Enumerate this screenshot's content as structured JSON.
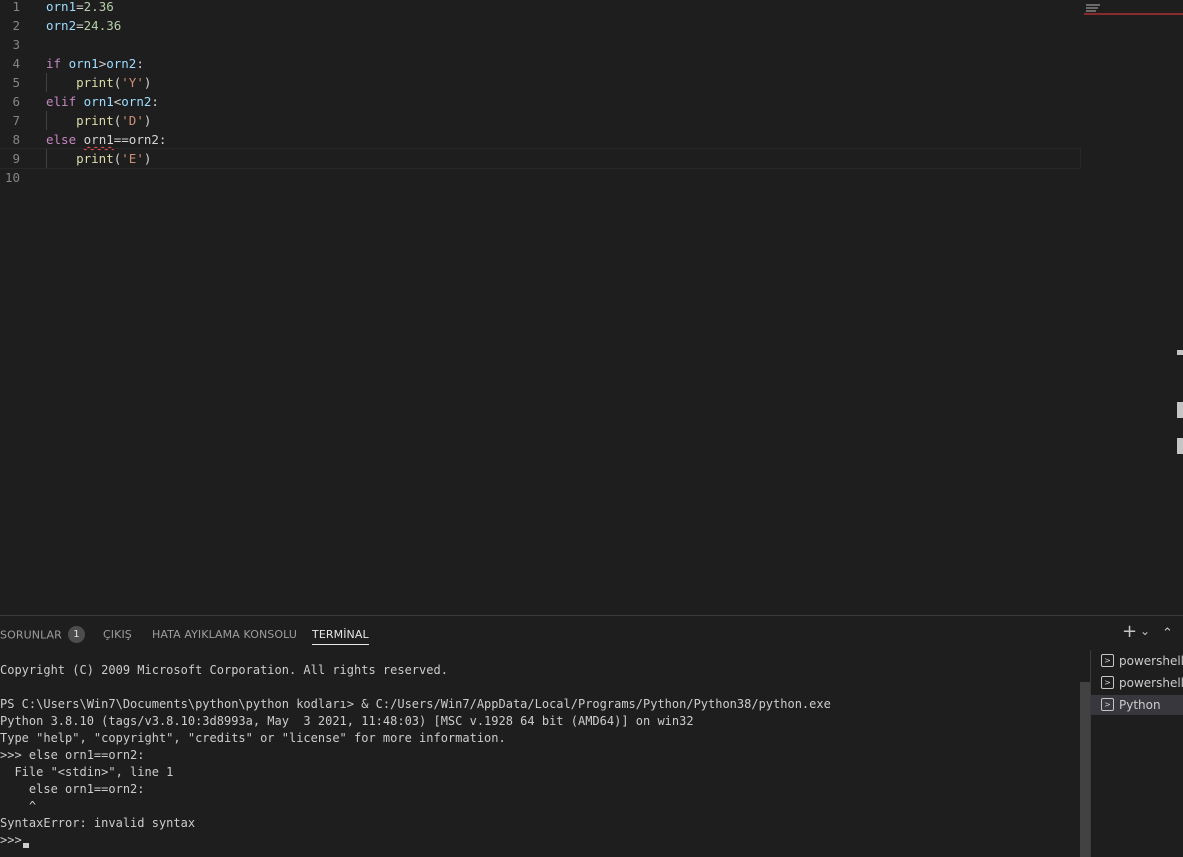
{
  "editor": {
    "lines": [
      {
        "n": "1",
        "tokens": [
          {
            "t": "orn1",
            "c": "id"
          },
          {
            "t": "=",
            "c": "op"
          },
          {
            "t": "2.36",
            "c": "num"
          }
        ]
      },
      {
        "n": "2",
        "tokens": [
          {
            "t": "orn2",
            "c": "id"
          },
          {
            "t": "=",
            "c": "op"
          },
          {
            "t": "24.36",
            "c": "num"
          }
        ]
      },
      {
        "n": "3",
        "tokens": []
      },
      {
        "n": "4",
        "tokens": [
          {
            "t": "if",
            "c": "kw"
          },
          {
            "t": " ",
            "c": "op"
          },
          {
            "t": "orn1",
            "c": "id"
          },
          {
            "t": ">",
            "c": "op"
          },
          {
            "t": "orn2",
            "c": "id"
          },
          {
            "t": ":",
            "c": "op"
          }
        ]
      },
      {
        "n": "5",
        "indent": true,
        "tokens": [
          {
            "t": "    ",
            "c": "op"
          },
          {
            "t": "print",
            "c": "fn"
          },
          {
            "t": "(",
            "c": "op"
          },
          {
            "t": "'Y'",
            "c": "str"
          },
          {
            "t": ")",
            "c": "op"
          }
        ]
      },
      {
        "n": "6",
        "tokens": [
          {
            "t": "elif",
            "c": "kw"
          },
          {
            "t": " ",
            "c": "op"
          },
          {
            "t": "orn1",
            "c": "id"
          },
          {
            "t": "<",
            "c": "op"
          },
          {
            "t": "orn2",
            "c": "id"
          },
          {
            "t": ":",
            "c": "op"
          }
        ]
      },
      {
        "n": "7",
        "indent": true,
        "tokens": [
          {
            "t": "    ",
            "c": "op"
          },
          {
            "t": "print",
            "c": "fn"
          },
          {
            "t": "(",
            "c": "op"
          },
          {
            "t": "'D'",
            "c": "str"
          },
          {
            "t": ")",
            "c": "op"
          }
        ]
      },
      {
        "n": "8",
        "tokens": [
          {
            "t": "else",
            "c": "kw"
          },
          {
            "t": " ",
            "c": "op"
          },
          {
            "t": "orn1",
            "c": "op",
            "err": true
          },
          {
            "t": "==orn2:",
            "c": "op"
          }
        ]
      },
      {
        "n": "9",
        "indent": true,
        "current": true,
        "tokens": [
          {
            "t": "    ",
            "c": "op"
          },
          {
            "t": "print",
            "c": "fn"
          },
          {
            "t": "(",
            "c": "op"
          },
          {
            "t": "'E'",
            "c": "str"
          },
          {
            "t": ")",
            "c": "op"
          }
        ]
      },
      {
        "n": "10",
        "tokens": []
      }
    ]
  },
  "panel": {
    "tabs": {
      "problems": "SORUNLAR",
      "problems_count": "1",
      "output": "ÇIKIŞ",
      "debug_console": "HATA AYIKLAMA KONSOLU",
      "terminal": "TERMİNAL"
    },
    "actions": {
      "add": "+",
      "dropdown": "⌄",
      "maximize": "⌃"
    },
    "terminal_lines": [
      "Copyright (C) 2009 Microsoft Corporation. All rights reserved.",
      "",
      "PS C:\\Users\\Win7\\Documents\\python\\python kodları> & C:/Users/Win7/AppData/Local/Programs/Python/Python38/python.exe",
      "Python 3.8.10 (tags/v3.8.10:3d8993a, May  3 2021, 11:48:03) [MSC v.1928 64 bit (AMD64)] on win32",
      "Type \"help\", \"copyright\", \"credits\" or \"license\" for more information.",
      ">>> else orn1==orn2:",
      "  File \"<stdin>\", line 1",
      "    else orn1==orn2:",
      "    ^",
      "SyntaxError: invalid syntax",
      ">>> "
    ],
    "terminal_list": [
      {
        "label": "powershell",
        "icon": "terminal-icon"
      },
      {
        "label": "powershell",
        "icon": "terminal-icon"
      },
      {
        "label": "Python",
        "icon": "terminal-icon",
        "selected": true
      }
    ]
  },
  "colors": {
    "background": "#1e1e1e",
    "keyword": "#c586c0",
    "identifier": "#9cdcfe",
    "number": "#b5cea8",
    "function": "#dcdcaa",
    "string": "#ce9178",
    "error_squiggle": "#f14c4c"
  }
}
